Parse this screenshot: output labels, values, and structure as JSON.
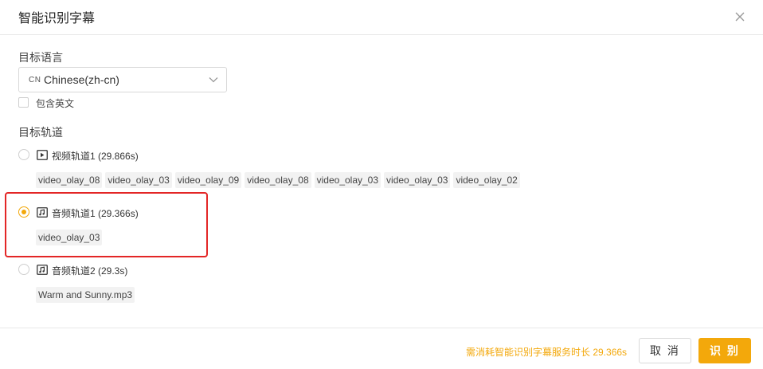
{
  "dialog": {
    "title": "智能识别字幕",
    "close_icon": "close-icon"
  },
  "language": {
    "label": "目标语言",
    "flag": "CN",
    "value": "Chinese(zh-cn)",
    "include_english_label": "包含英文",
    "include_english_checked": false
  },
  "tracks": {
    "label": "目标轨道",
    "items": [
      {
        "icon": "video-track-icon",
        "title": "视频轨道1 (29.866s)",
        "selected": false,
        "clips": [
          "video_olay_08",
          "video_olay_03",
          "video_olay_09",
          "video_olay_08",
          "video_olay_03",
          "video_olay_03",
          "video_olay_02"
        ]
      },
      {
        "icon": "audio-track-icon",
        "title": "音频轨道1 (29.366s)",
        "selected": true,
        "clips": [
          "video_olay_03"
        ]
      },
      {
        "icon": "audio-track-icon",
        "title": "音频轨道2 (29.3s)",
        "selected": false,
        "clips": [
          "Warm and Sunny.mp3"
        ]
      }
    ]
  },
  "footer": {
    "cost_note": "需消耗智能识别字幕服务时长 29.366s",
    "cancel_label": "取 消",
    "ok_label": "识 别"
  },
  "colors": {
    "accent": "#f3a80b",
    "highlight": "#e32626"
  }
}
